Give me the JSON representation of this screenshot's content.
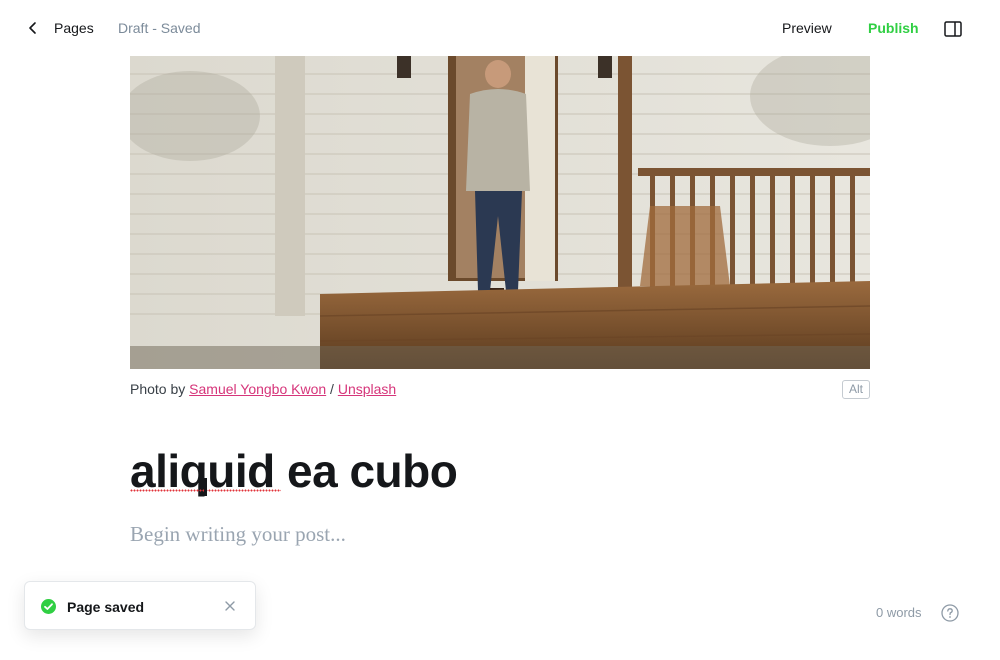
{
  "header": {
    "back_label": "Pages",
    "status": "Draft - Saved",
    "preview_label": "Preview",
    "publish_label": "Publish",
    "icons": {
      "back": "chevron-left-icon",
      "sidebar": "sidebar-toggle-icon"
    }
  },
  "feature_image": {
    "caption_prefix": "Photo by",
    "author": "Samuel Yongbo Kwon",
    "separator": "/",
    "source": "Unsplash",
    "alt_label": "Alt"
  },
  "post": {
    "title": "aliquid ea cubo",
    "body_placeholder": "Begin writing your post..."
  },
  "toast": {
    "message": "Page saved",
    "icons": {
      "status": "check-circle-icon",
      "close": "close-icon"
    }
  },
  "footer": {
    "word_count": "0 words",
    "help_icon": "help-icon"
  },
  "colors": {
    "publish": "#30cf43",
    "link": "#d6357a",
    "muted": "#7c8b9a",
    "success": "#30cf43"
  }
}
